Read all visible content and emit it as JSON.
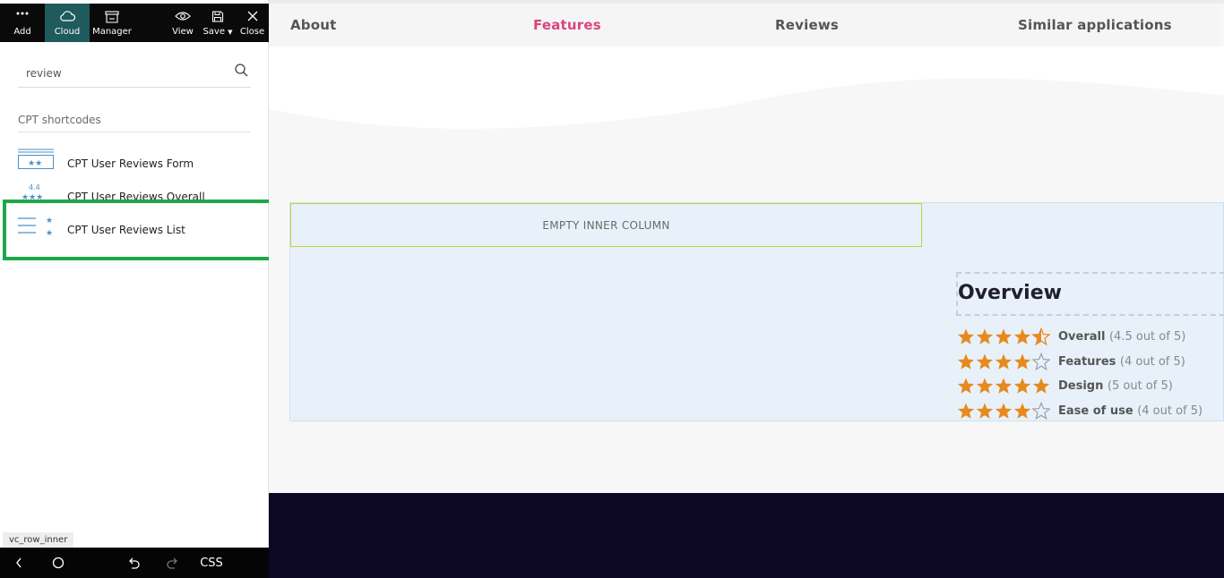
{
  "toolbar": {
    "add": "Add",
    "cloud": "Cloud",
    "manager": "Manager",
    "view": "View",
    "save": "Save",
    "close": "Close"
  },
  "search": {
    "value": "review",
    "placeholder": ""
  },
  "shortcodes": {
    "section_title": "CPT shortcodes",
    "items": [
      {
        "label": "CPT User Reviews Form",
        "icon": "stars-form-icon"
      },
      {
        "label": "CPT User Reviews Overall",
        "icon": "stars-overall-icon",
        "icon_text": "4.4"
      },
      {
        "label": "CPT User Reviews List",
        "icon": "stars-list-icon"
      }
    ]
  },
  "breadcrumb": "vc_row_inner",
  "bottombar": {
    "css": "CSS"
  },
  "nav": {
    "tabs": [
      {
        "label": "About"
      },
      {
        "label": "Features",
        "active": true
      },
      {
        "label": "Reviews"
      },
      {
        "label": "Similar applications"
      }
    ]
  },
  "content": {
    "empty_column": "EMPTY INNER COLUMN",
    "overview_title": "Overview",
    "ratings": [
      {
        "label": "Overall",
        "score": "(4.5 out of 5)",
        "value": 4.5
      },
      {
        "label": "Features",
        "score": "(4 out of 5)",
        "value": 4
      },
      {
        "label": "Design",
        "score": "(5 out of 5)",
        "value": 5
      },
      {
        "label": "Ease of use",
        "score": "(4 out of 5)",
        "value": 4
      }
    ]
  },
  "colors": {
    "accent": "#d9467d",
    "star": "#e78a1e",
    "highlight": "#1ea84a",
    "toolbar_bg": "#0a0a0a",
    "active_tool": "#1f5a5c",
    "footer": "#0c0823"
  }
}
